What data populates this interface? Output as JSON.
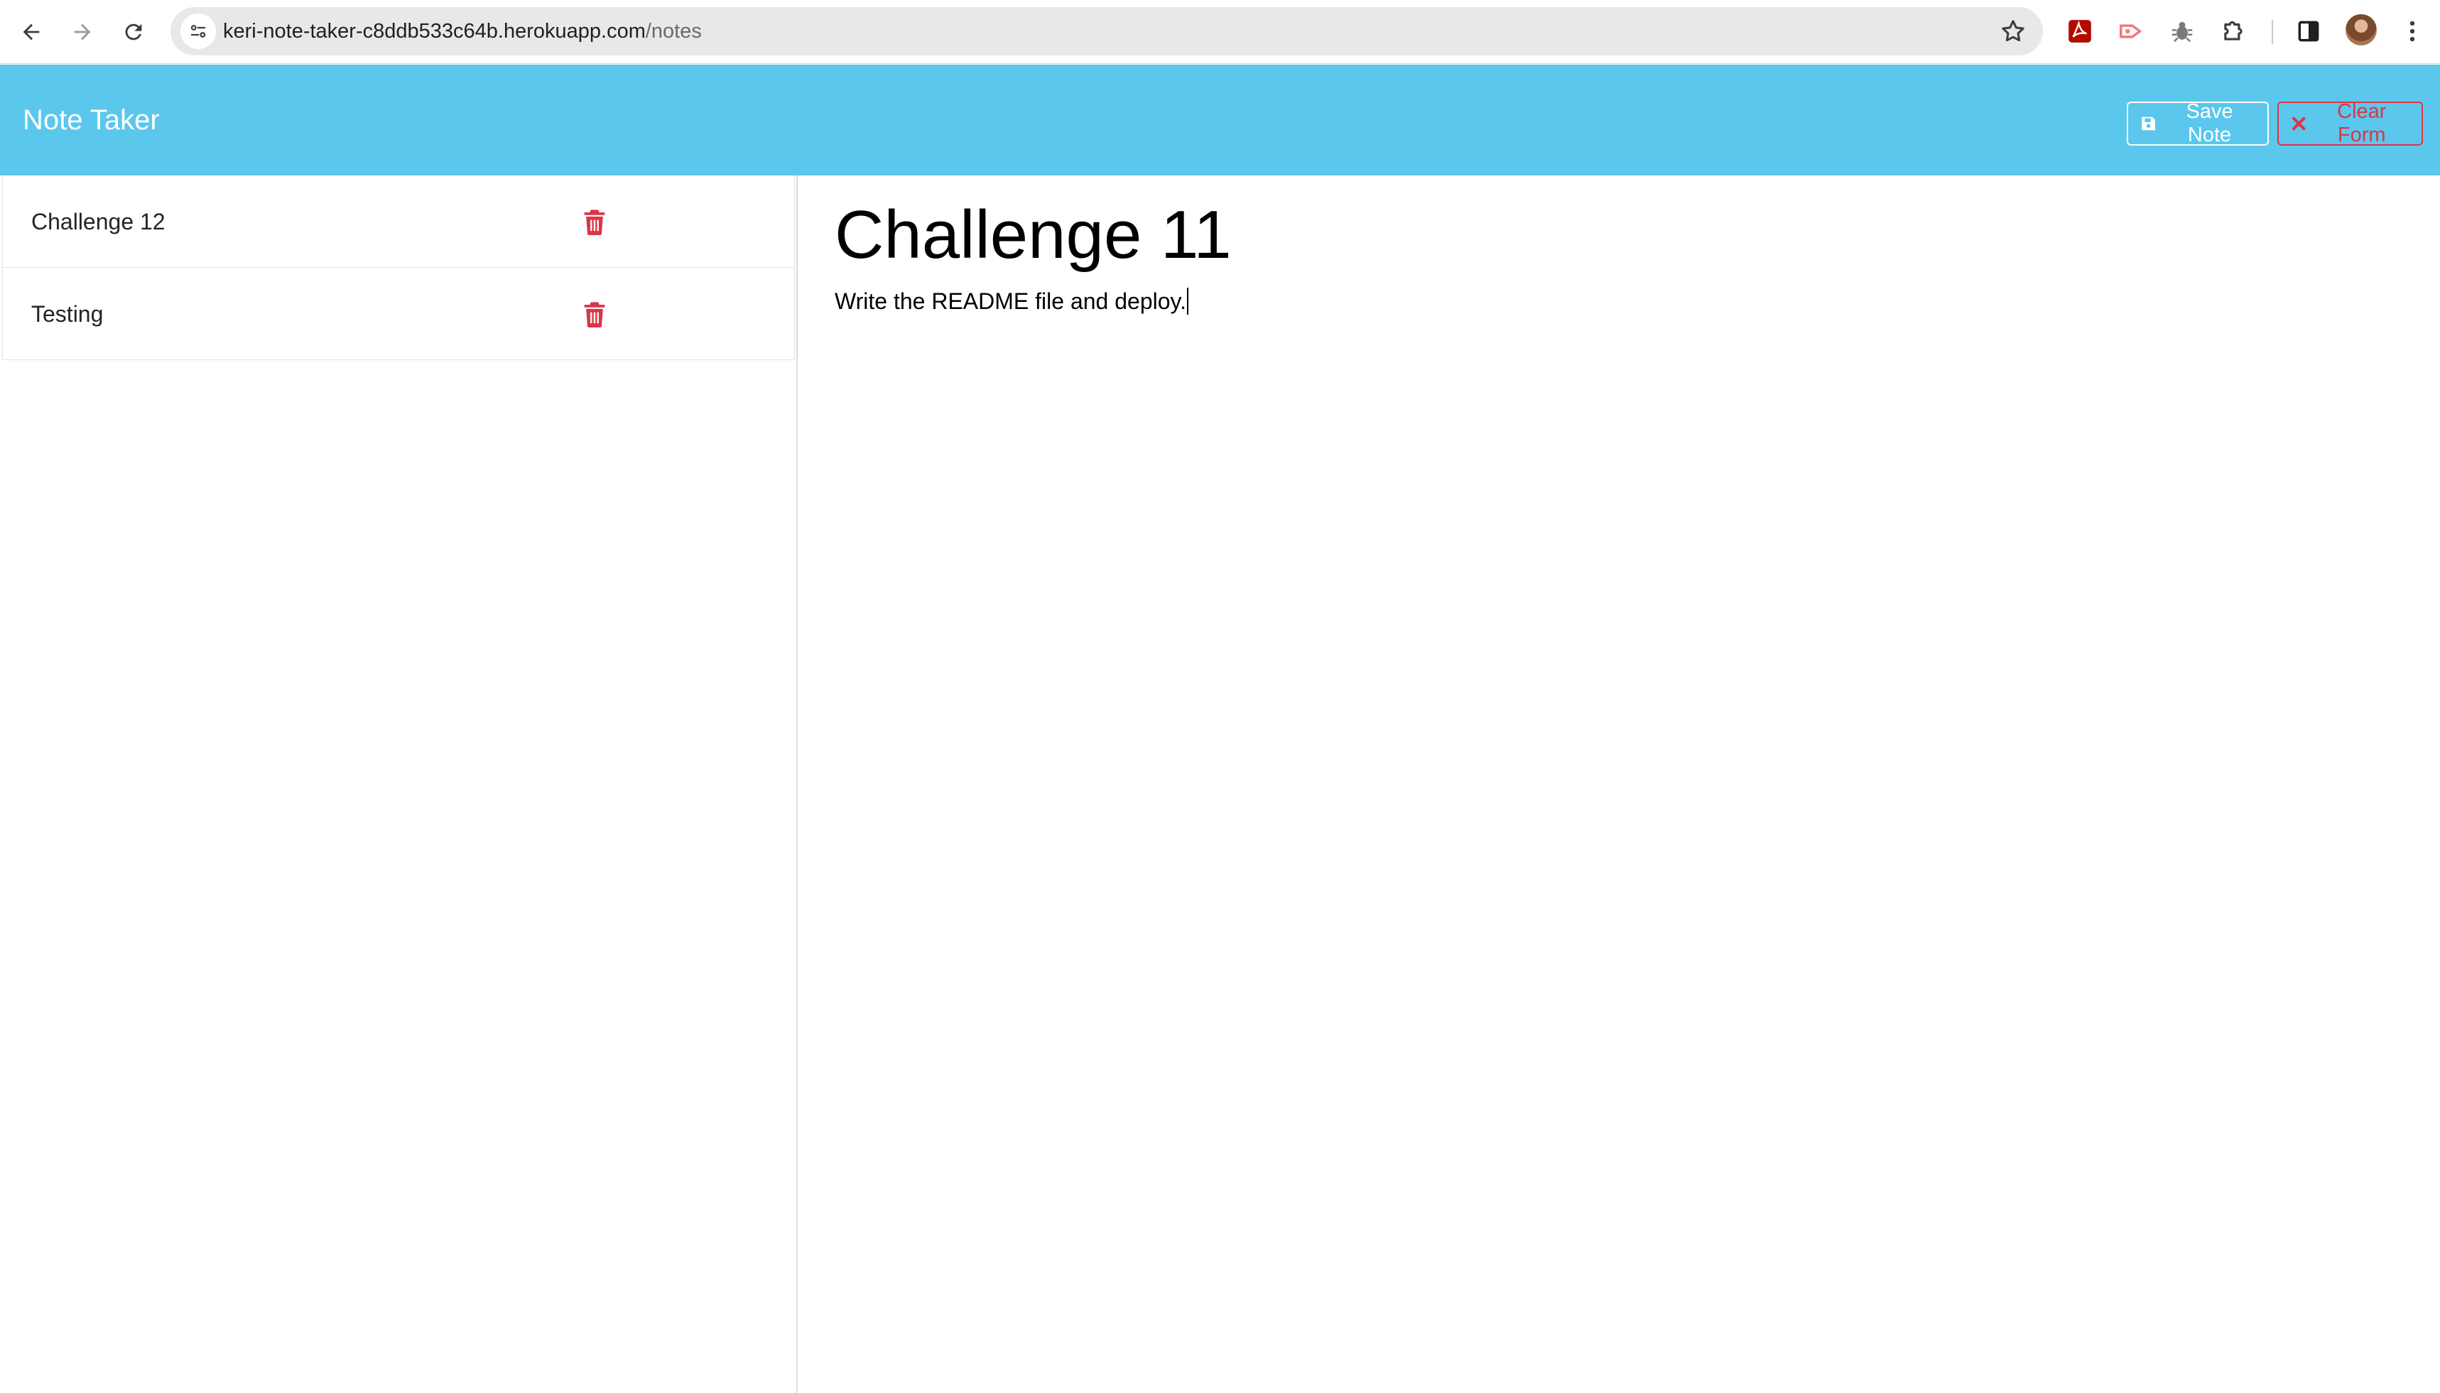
{
  "browser": {
    "url_host": "keri-note-taker-c8ddb533c64b.herokuapp.com",
    "url_path": "/notes",
    "icons": [
      "back-icon",
      "forward-icon",
      "reload-icon",
      "site-info-icon",
      "bookmark-star-icon",
      "pdf-extension-icon",
      "screen-recorder-extension-icon",
      "bug-extension-icon",
      "extensions-puzzle-icon",
      "side-panel-icon",
      "profile-avatar",
      "more-menu-icon"
    ]
  },
  "navbar": {
    "brand": "Note Taker",
    "save_label": "Save Note",
    "clear_label": "Clear Form",
    "bg_color": "#5bc7ec",
    "danger_color": "#dc3545"
  },
  "sidebar": {
    "notes": [
      {
        "title": "Challenge 12"
      },
      {
        "title": "Testing"
      }
    ]
  },
  "editor": {
    "title": "Challenge 11",
    "text": "Write the README file and deploy."
  }
}
